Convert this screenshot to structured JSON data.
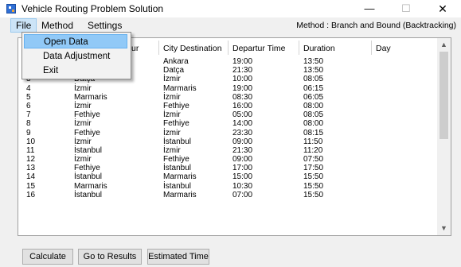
{
  "window": {
    "title": "Vehicle Routing Problem Solution",
    "minimize_glyph": "—",
    "maximize_glyph": "☐",
    "close_glyph": "✕",
    "app_icon": "grid-app-icon"
  },
  "menu": {
    "file": "File",
    "method": "Method",
    "settings": "Settings",
    "status": "Method : Branch and Bound (Backtracking)"
  },
  "file_menu": {
    "open_data": "Open Data",
    "data_adjustment": "Data Adjustment",
    "exit": "Exit"
  },
  "grid": {
    "headers": {
      "source_fragment": "ur",
      "destination": "City Destination",
      "departure": "Departur Time",
      "duration": "Duration",
      "day": "Day"
    },
    "rows": [
      {
        "idx": "",
        "src": "",
        "dst": "Ankara",
        "dep": "19:00",
        "dur": "13:50",
        "day": ""
      },
      {
        "idx": "",
        "src": "",
        "dst": "Datça",
        "dep": "21:30",
        "dur": "13:50",
        "day": ""
      },
      {
        "idx": "3",
        "src": "Datça",
        "dst": "İzmir",
        "dep": "10:00",
        "dur": "08:05",
        "day": ""
      },
      {
        "idx": "4",
        "src": "İzmir",
        "dst": "Marmaris",
        "dep": "19:00",
        "dur": "06:15",
        "day": ""
      },
      {
        "idx": "5",
        "src": "Marmaris",
        "dst": "İzmir",
        "dep": "08:30",
        "dur": "06:05",
        "day": ""
      },
      {
        "idx": "6",
        "src": "İzmir",
        "dst": "Fethiye",
        "dep": "16:00",
        "dur": "08:00",
        "day": ""
      },
      {
        "idx": "7",
        "src": "Fethiye",
        "dst": "İzmir",
        "dep": "05:00",
        "dur": "08:05",
        "day": ""
      },
      {
        "idx": "8",
        "src": "İzmir",
        "dst": "Fethiye",
        "dep": "14:00",
        "dur": "08:00",
        "day": ""
      },
      {
        "idx": "9",
        "src": "Fethiye",
        "dst": "İzmir",
        "dep": "23:30",
        "dur": "08:15",
        "day": ""
      },
      {
        "idx": "10",
        "src": "İzmir",
        "dst": "İstanbul",
        "dep": "09:00",
        "dur": "11:50",
        "day": ""
      },
      {
        "idx": "11",
        "src": "İstanbul",
        "dst": "İzmir",
        "dep": "21:30",
        "dur": "11:20",
        "day": ""
      },
      {
        "idx": "12",
        "src": "İzmir",
        "dst": "Fethiye",
        "dep": "09:00",
        "dur": "07:50",
        "day": ""
      },
      {
        "idx": "13",
        "src": "Fethiye",
        "dst": "İstanbul",
        "dep": "17:00",
        "dur": "17:50",
        "day": ""
      },
      {
        "idx": "14",
        "src": "İstanbul",
        "dst": "Marmaris",
        "dep": "15:00",
        "dur": "15:50",
        "day": ""
      },
      {
        "idx": "15",
        "src": "Marmaris",
        "dst": "İstanbul",
        "dep": "10:30",
        "dur": "15:50",
        "day": ""
      },
      {
        "idx": "16",
        "src": "İstanbul",
        "dst": "Marmaris",
        "dep": "07:00",
        "dur": "15:50",
        "day": ""
      }
    ],
    "scroll_up_glyph": "▲",
    "scroll_down_glyph": "▼"
  },
  "buttons": {
    "calculate": "Calculate",
    "go_to_results": "Go to Results",
    "estimated_time": "Estimated Time"
  }
}
